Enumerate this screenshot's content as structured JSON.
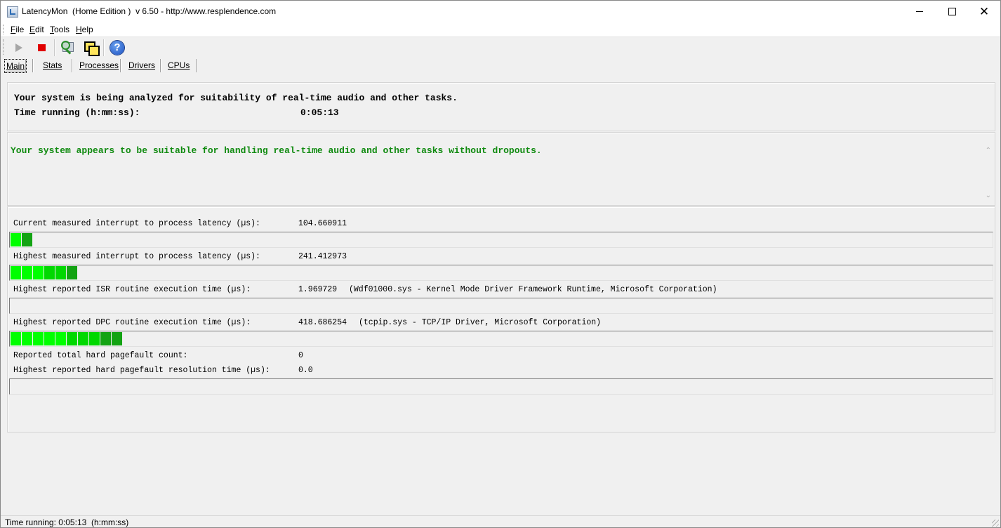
{
  "window": {
    "title": "LatencyMon  (Home Edition )  v 6.50 - http://www.resplendence.com"
  },
  "menu": {
    "items": [
      {
        "u": "F",
        "rest": "ile"
      },
      {
        "u": "E",
        "rest": "dit"
      },
      {
        "u": "T",
        "rest": "ools"
      },
      {
        "u": "H",
        "rest": "elp"
      }
    ]
  },
  "toolbar": {
    "help_glyph": "?"
  },
  "tabs": [
    {
      "label": "Main",
      "active": true
    },
    {
      "label": "Stats",
      "active": false
    },
    {
      "label": "Processes",
      "active": false
    },
    {
      "label": "Drivers",
      "active": false
    },
    {
      "label": "CPUs",
      "active": false
    }
  ],
  "status_panel": {
    "line1": "Your system is being analyzed for suitability of real-time audio and other tasks.",
    "time_label": "Time running (h:mm:ss):",
    "time_value": "0:05:13"
  },
  "verdict": {
    "text": "Your system appears to be suitable for handling real-time audio and other tasks without dropouts.",
    "color": "#0f8a0f"
  },
  "metrics": [
    {
      "label": "Current measured interrupt to process latency (µs):",
      "value": "104.660911",
      "detail": "",
      "bar_segments": 2
    },
    {
      "label": "Highest measured interrupt to process latency (µs):",
      "value": "241.412973",
      "detail": "",
      "bar_segments": 6
    },
    {
      "label": "Highest reported ISR routine execution time (µs):",
      "value": "1.969729",
      "detail": "(Wdf01000.sys - Kernel Mode Driver Framework Runtime, Microsoft Corporation)",
      "bar_segments": 0
    },
    {
      "label": "Highest reported DPC routine execution time (µs):",
      "value": "418.686254",
      "detail": "(tcpip.sys - TCP/IP Driver, Microsoft Corporation)",
      "bar_segments": 10
    }
  ],
  "pagefault": {
    "count_label": "Reported total hard pagefault count:",
    "count_value": "0",
    "time_label": "Highest reported hard pagefault resolution time (µs):",
    "time_value": "0.0",
    "bar_segments": 0
  },
  "statusbar": {
    "text": "Time running: 0:05:13  (h:mm:ss)"
  },
  "colors": {
    "bar_bright": "#00ff00",
    "bar_mid": "#00d800",
    "bar_dark": "#13a313"
  }
}
